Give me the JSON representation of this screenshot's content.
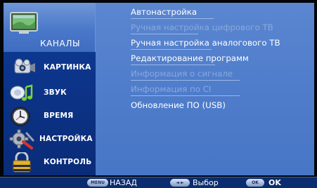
{
  "sidebar": {
    "selected": {
      "label": "КАНАЛЫ",
      "icon": "tv-icon"
    },
    "items": [
      {
        "label": "КАРТИНКА",
        "icon": "camera-icon"
      },
      {
        "label": "ЗВУК",
        "icon": "sound-icon"
      },
      {
        "label": "ВРЕМЯ",
        "icon": "clock-icon"
      },
      {
        "label": "НАСТРОЙКА",
        "icon": "settings-icon"
      },
      {
        "label": "КОНТРОЛЬ",
        "icon": "lock-icon"
      }
    ]
  },
  "menu": {
    "items": [
      {
        "label": "Автонастройка",
        "enabled": true
      },
      {
        "label": "Ручная настройка цифрового ТВ",
        "enabled": false
      },
      {
        "label": "Ручная настройка аналогового ТВ",
        "enabled": true
      },
      {
        "label": "Редактирование программ",
        "enabled": true
      },
      {
        "label": "Информация о сигнале",
        "enabled": false
      },
      {
        "label": "Информация по CI",
        "enabled": false
      },
      {
        "label": "Обновление ПО (USB)",
        "enabled": true
      }
    ]
  },
  "hints": [
    {
      "key": "MENU",
      "label": "НАЗАД"
    },
    {
      "key": "◄ ►",
      "label": "Выбор"
    },
    {
      "key": "OK",
      "label": "OK"
    }
  ],
  "colors": {
    "sidebar_bg": "#0c3489",
    "panel_bg": "#4f7dcb",
    "selected_bg": "#5a86d0",
    "disabled_text": "#8aa9dc"
  }
}
